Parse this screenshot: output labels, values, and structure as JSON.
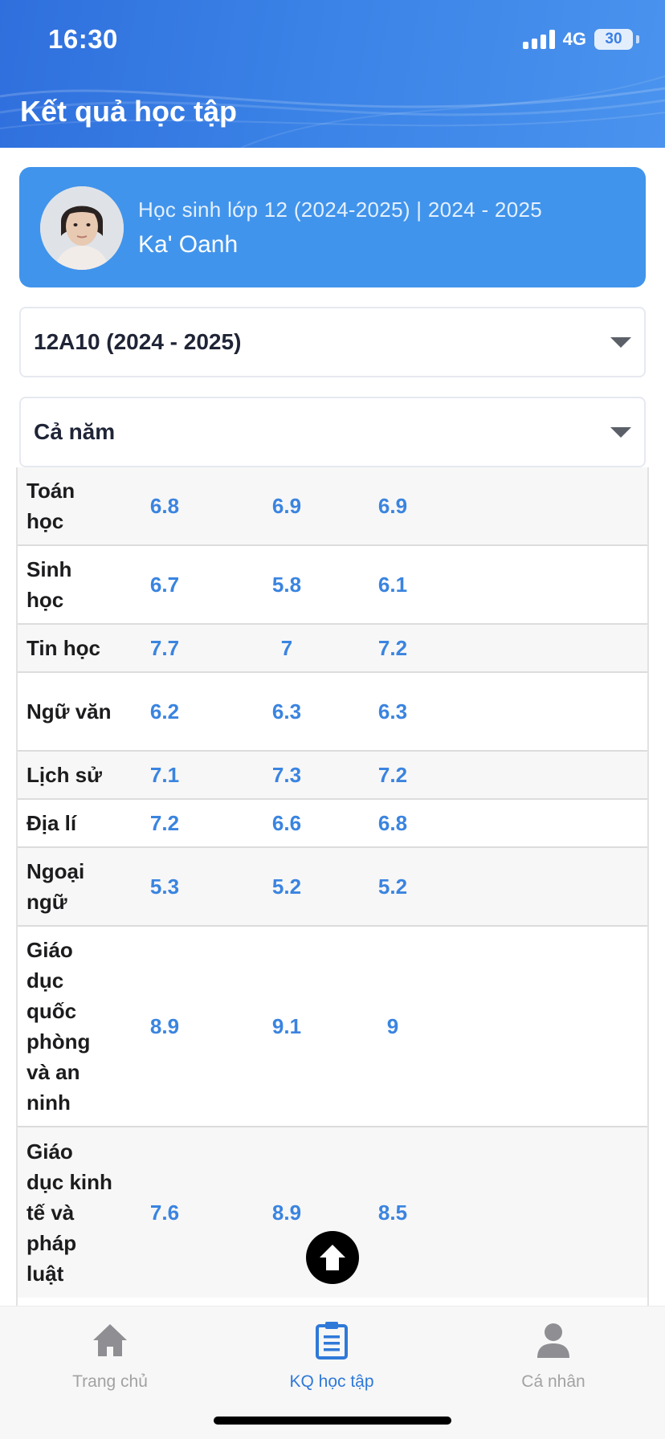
{
  "status_bar": {
    "time": "16:30",
    "network": "4G",
    "battery": "30"
  },
  "header": {
    "title": "Kết quả học tập"
  },
  "student": {
    "subtitle": "Học sinh lớp 12 (2024-2025) | 2024 - 2025",
    "name": "Ka' Oanh"
  },
  "filters": {
    "class_value": "12A10 (2024 - 2025)",
    "term_value": "Cả năm"
  },
  "grades": [
    {
      "subject": "Toán học",
      "s1": "6.8",
      "s2": "6.9",
      "s3": "6.9"
    },
    {
      "subject": "Sinh học",
      "s1": "6.7",
      "s2": "5.8",
      "s3": "6.1"
    },
    {
      "subject": "Tin học",
      "s1": "7.7",
      "s2": "7",
      "s3": "7.2"
    },
    {
      "subject": "Ngữ văn",
      "s1": "6.2",
      "s2": "6.3",
      "s3": "6.3"
    },
    {
      "subject": "Lịch sử",
      "s1": "7.1",
      "s2": "7.3",
      "s3": "7.2"
    },
    {
      "subject": "Địa lí",
      "s1": "7.2",
      "s2": "6.6",
      "s3": "6.8"
    },
    {
      "subject": "Ngoại ngữ",
      "s1": "5.3",
      "s2": "5.2",
      "s3": "5.2"
    },
    {
      "subject": "Giáo dục quốc phòng và an ninh",
      "s1": "8.9",
      "s2": "9.1",
      "s3": "9"
    },
    {
      "subject": "Giáo dục kinh tế và pháp luật",
      "s1": "7.6",
      "s2": "8.9",
      "s3": "8.5"
    }
  ],
  "tabbar": {
    "home": "Trang chủ",
    "results": "KQ học tập",
    "profile": "Cá nhân"
  },
  "colors": {
    "header_blue": "#3a82e6",
    "card_blue": "#4194eb",
    "score_blue": "#3a84e0",
    "active_tab": "#2f79d8",
    "inactive_tab": "#a2a2a2"
  },
  "icons": {
    "home": "home-icon",
    "results": "clipboard-icon",
    "profile": "person-icon",
    "dropdown": "caret-down-icon",
    "scroll_top": "arrow-up-icon"
  }
}
